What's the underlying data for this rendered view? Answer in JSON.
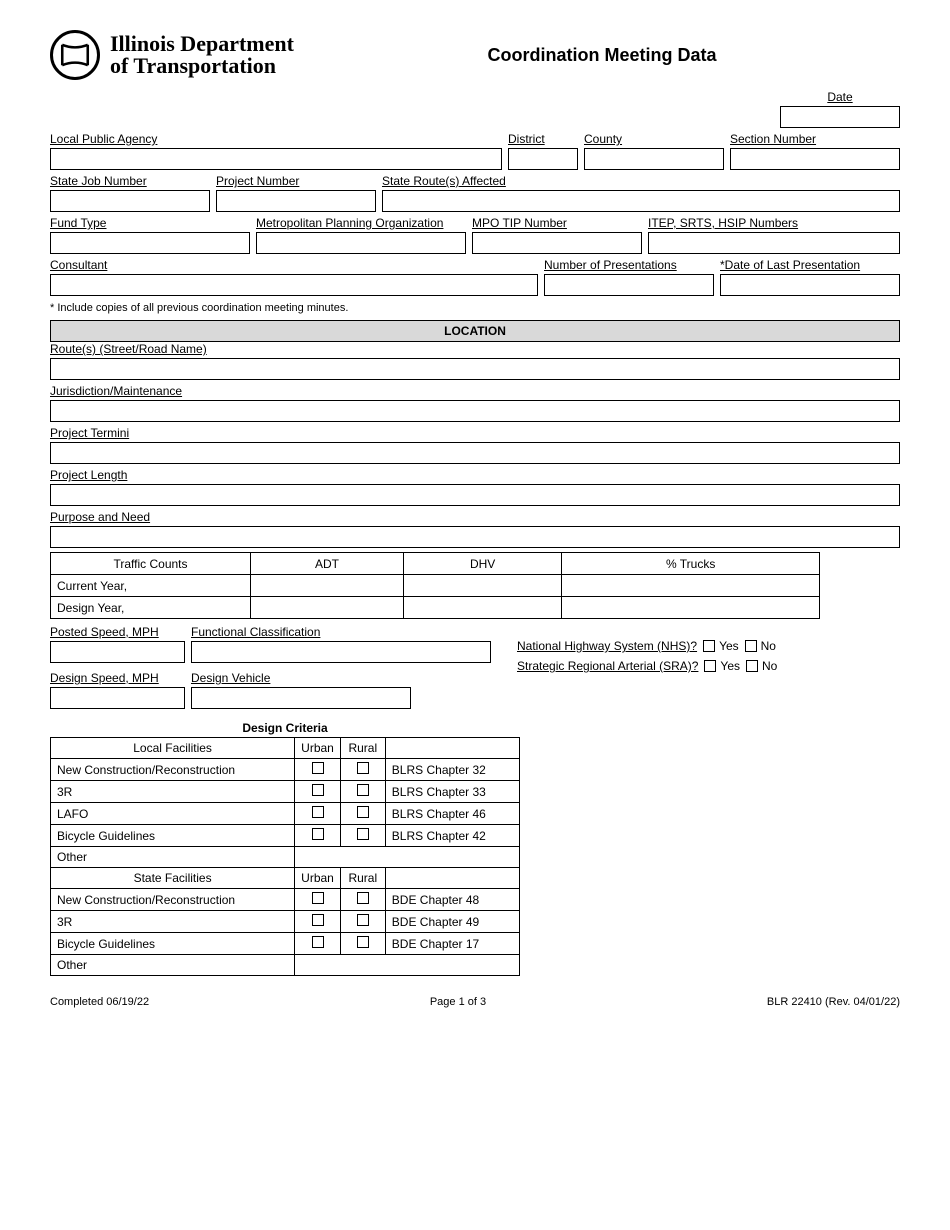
{
  "header": {
    "logo_text_line1": "Illinois Department",
    "logo_text_line2": "of Transportation",
    "form_title": "Coordination Meeting Data"
  },
  "fields": {
    "date_label": "Date",
    "date": "",
    "lpa_label": "Local Public Agency",
    "lpa": "",
    "district_label": "District",
    "district": "",
    "county_label": "County",
    "county": "",
    "section_label": "Section Number",
    "section": "",
    "state_job_label": "State Job Number",
    "state_job": "",
    "project_number_label": "Project Number",
    "project_number": "",
    "routes_affected_label": "State Route(s) Affected",
    "routes_affected": "",
    "fund_type_label": "Fund Type",
    "fund_type": "",
    "mpo_label": "Metropolitan Planning Organization",
    "mpo": "",
    "tip_label": "MPO TIP Number",
    "tip": "",
    "itep_label": "ITEP, SRTS, HSIP Numbers",
    "itep": "",
    "consultant_label": "Consultant",
    "consultant": "",
    "num_pres_label": "Number of Presentations",
    "num_pres": "",
    "last_pres_label": "*Date of Last Presentation",
    "last_pres": "",
    "note": "* Include copies of all previous coordination meeting minutes."
  },
  "location": {
    "header": "LOCATION",
    "route_label": "Route(s) (Street/Road Name)",
    "route": "",
    "jurisdiction_label": "Jurisdiction/Maintenance",
    "jurisdiction": "",
    "termini_label": "Project Termini",
    "termini": "",
    "length_label": "Project Length",
    "length": "",
    "purpose_label": "Purpose and Need",
    "purpose": ""
  },
  "traffic": {
    "col_left": "Traffic Counts",
    "col_adt": "ADT",
    "col_dhv": "DHV",
    "col_trucks": "% Trucks",
    "row_current": "Current Year,",
    "row_design": "Design Year,"
  },
  "speed": {
    "posted_label": "Posted Speed, MPH",
    "posted": "",
    "func_class_label": "Functional Classification",
    "func_class": "",
    "nhs_label": "National Highway System (NHS)?",
    "sra_label": "Strategic Regional Arterial (SRA)?",
    "yes": "Yes",
    "no": "No",
    "design_speed_label": "Design Speed, MPH",
    "design_speed": "",
    "design_vehicle_label": "Design Vehicle",
    "design_vehicle": ""
  },
  "design": {
    "title": "Design Criteria",
    "col_local": "Local Facilities",
    "col_state": "State Facilities",
    "col_urban": "Urban",
    "col_rural": "Rural",
    "rows_local": [
      {
        "label": "New Construction/Reconstruction",
        "chapter": "BLRS Chapter 32"
      },
      {
        "label": "3R",
        "chapter": "BLRS Chapter 33"
      },
      {
        "label": "LAFO",
        "chapter": "BLRS Chapter 46"
      },
      {
        "label": "Bicycle Guidelines",
        "chapter": "BLRS Chapter 42"
      },
      {
        "label": "Other",
        "chapter": ""
      }
    ],
    "rows_state": [
      {
        "label": "New Construction/Reconstruction",
        "chapter": "BDE Chapter 48"
      },
      {
        "label": "3R",
        "chapter": "BDE Chapter 49"
      },
      {
        "label": "Bicycle Guidelines",
        "chapter": "BDE Chapter 17"
      },
      {
        "label": "Other",
        "chapter": ""
      }
    ]
  },
  "footer": {
    "completed_label": "Completed",
    "completed_date": "06/19/22",
    "page": "Page 1 of 3",
    "form_rev": "BLR 22410 (Rev. 04/01/22)"
  }
}
